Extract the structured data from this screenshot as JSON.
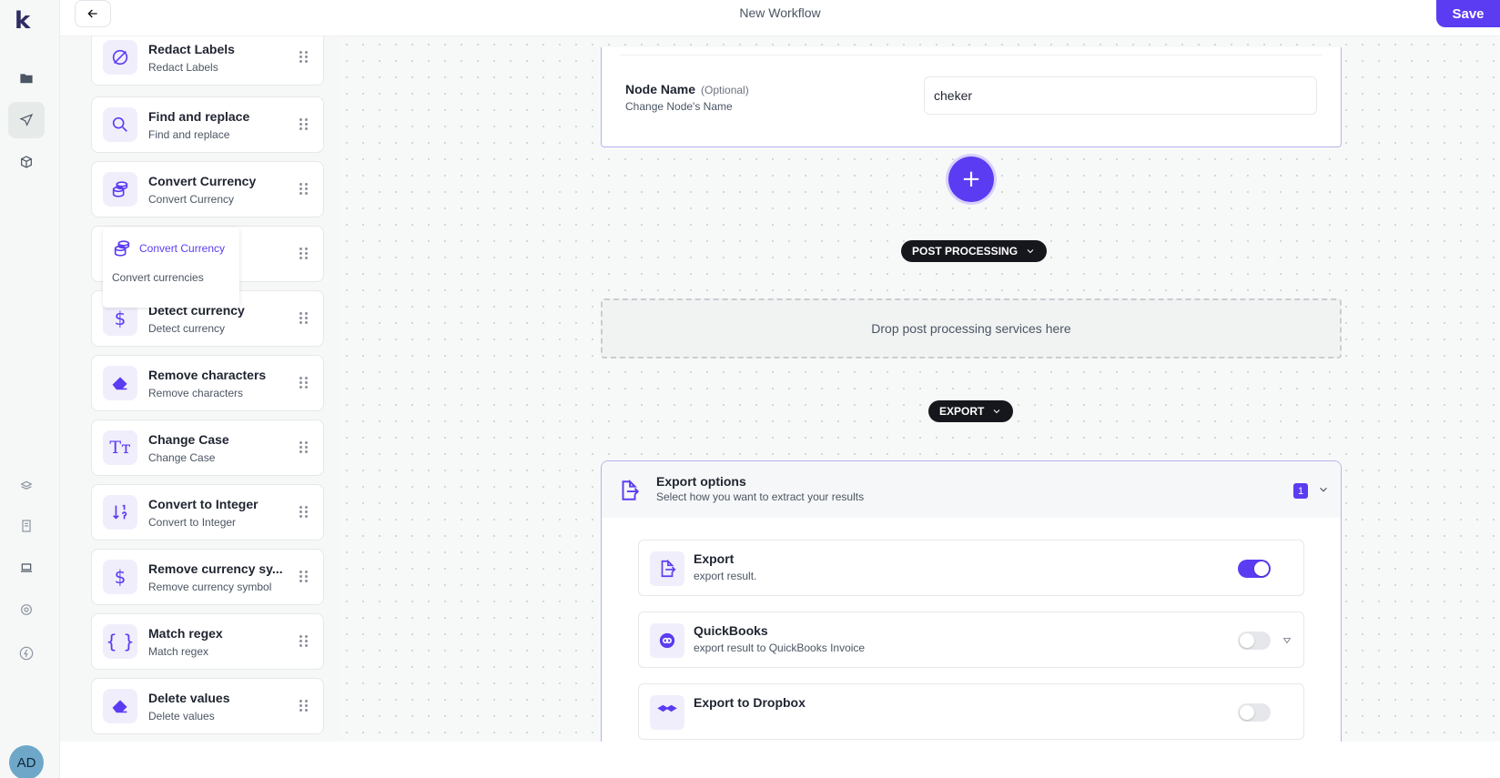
{
  "app": {
    "logo_letter": "k",
    "workflow_title": "New Workflow",
    "save_label": "Save",
    "user_initials": "AD",
    "accent_color": "#5b3cf2"
  },
  "rail": {
    "items": [
      {
        "icon": "folder-icon"
      },
      {
        "icon": "send-icon",
        "active": true
      },
      {
        "icon": "cube-icon"
      },
      {
        "icon": "layers-icon"
      },
      {
        "icon": "document-icon"
      },
      {
        "icon": "laptop-icon"
      },
      {
        "icon": "gear-icon"
      },
      {
        "icon": "bolt-icon"
      }
    ]
  },
  "services": [
    {
      "title": "Redact Labels",
      "subtitle": "Redact Labels",
      "icon": "redact-icon"
    },
    {
      "title": "Find and replace",
      "subtitle": "Find and replace",
      "icon": "search-icon"
    },
    {
      "title": "Convert Currency",
      "subtitle": "Convert Currency",
      "icon": "coins-icon"
    },
    {
      "title": "",
      "subtitle": "",
      "icon": "coins-icon"
    },
    {
      "title": "Detect currency",
      "subtitle": "Detect currency",
      "icon": "dollar-icon"
    },
    {
      "title": "Remove characters",
      "subtitle": "Remove characters",
      "icon": "eraser-icon"
    },
    {
      "title": "Change Case",
      "subtitle": "Change Case",
      "icon": "text-case-icon"
    },
    {
      "title": "Convert to Integer",
      "subtitle": "Convert to Integer",
      "icon": "sort-numeric-icon"
    },
    {
      "title": "Remove currency sy...",
      "subtitle": "Remove currency symbol",
      "icon": "dollar-icon"
    },
    {
      "title": "Match regex",
      "subtitle": "Match regex",
      "icon": "braces-icon"
    },
    {
      "title": "Delete values",
      "subtitle": "Delete values",
      "icon": "eraser-icon"
    }
  ],
  "tooltip": {
    "title": "Convert Currency",
    "description": "Convert currencies"
  },
  "node": {
    "label": "Node Name",
    "optional": "(Optional)",
    "sub": "Change Node's Name",
    "value": "cheker"
  },
  "post_processing": {
    "label": "POST PROCESSING",
    "drop_hint": "Drop post processing services here"
  },
  "export": {
    "label": "EXPORT",
    "panel_title": "Export options",
    "panel_sub": "Select how you want to extract your results",
    "count": "1",
    "items": [
      {
        "title": "Export",
        "subtitle": "export result.",
        "enabled": true,
        "icon": "export-icon"
      },
      {
        "title": "QuickBooks",
        "subtitle": "export result to QuickBooks Invoice",
        "enabled": false,
        "icon": "quickbooks-icon"
      },
      {
        "title": "Export to Dropbox",
        "subtitle": "",
        "enabled": false,
        "icon": "dropbox-icon"
      }
    ]
  }
}
